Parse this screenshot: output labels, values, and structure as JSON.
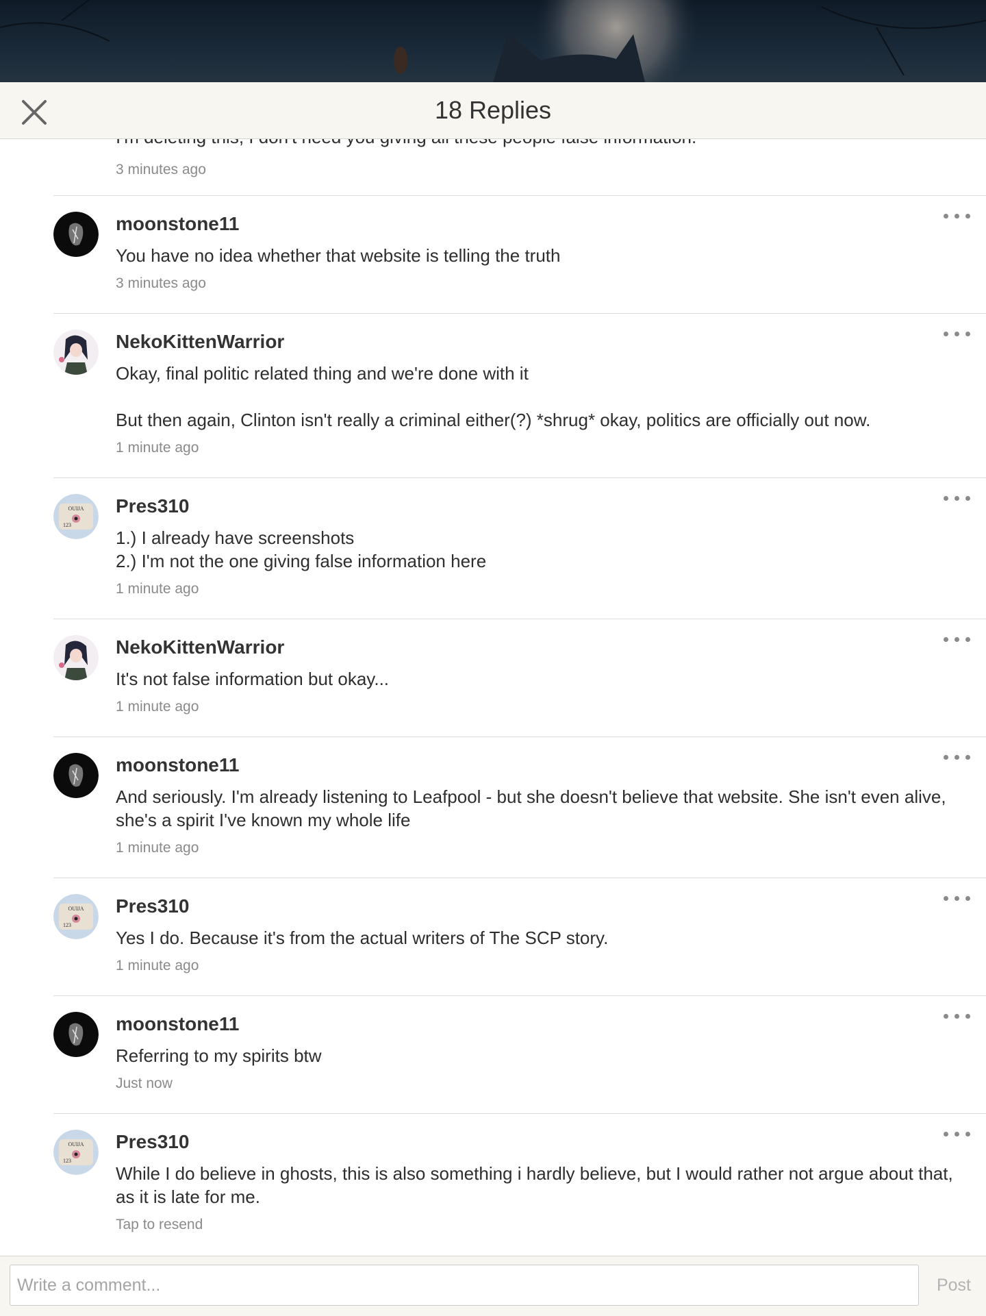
{
  "header": {
    "title": "18 Replies",
    "close_icon": "close-icon"
  },
  "partial_comment": {
    "text": "I'm deleting this, I don't need you giving all these people false information.",
    "time": "3 minutes ago"
  },
  "comments": [
    {
      "user": "moonstone11",
      "avatar": "dark-feline-avatar",
      "lines": [
        "You have no idea whether that website is telling the truth"
      ],
      "time": "3 minutes ago"
    },
    {
      "user": "NekoKittenWarrior",
      "avatar": "anime-girl-avatar",
      "lines": [
        "Okay, final politic related thing and we're done with it",
        "",
        "But then again, Clinton isn't really a criminal either(?) *shrug* okay, politics are officially out now."
      ],
      "time": "1 minute ago"
    },
    {
      "user": "Pres310",
      "avatar": "ouija-board-avatar",
      "lines": [
        "1.) I already have screenshots",
        "2.) I'm not the one giving false information here"
      ],
      "time": "1 minute ago"
    },
    {
      "user": "NekoKittenWarrior",
      "avatar": "anime-girl-avatar",
      "lines": [
        "It's not false information but okay..."
      ],
      "time": "1 minute ago"
    },
    {
      "user": "moonstone11",
      "avatar": "dark-feline-avatar",
      "lines": [
        "And seriously. I'm already listening to Leafpool - but she doesn't believe that website. She isn't even alive, she's a spirit I've known my whole life"
      ],
      "time": "1 minute ago"
    },
    {
      "user": "Pres310",
      "avatar": "ouija-board-avatar",
      "lines": [
        "Yes I do. Because it's from the actual writers of The SCP story."
      ],
      "time": "1 minute ago"
    },
    {
      "user": "moonstone11",
      "avatar": "dark-feline-avatar",
      "lines": [
        "Referring to my spirits btw"
      ],
      "time": "Just now"
    },
    {
      "user": "Pres310",
      "avatar": "ouija-board-avatar",
      "lines": [
        "While I do believe in ghosts, this is also something i hardly believe, but I would rather not argue about that, as it is late for me."
      ],
      "time": "Tap to resend"
    }
  ],
  "footer": {
    "placeholder": "Write a comment...",
    "post_label": "Post"
  },
  "colors": {
    "header_bg": "#f7f6f1",
    "text": "#2e2e2e",
    "muted": "#8a8a8a",
    "divider": "#dcdcdc"
  }
}
